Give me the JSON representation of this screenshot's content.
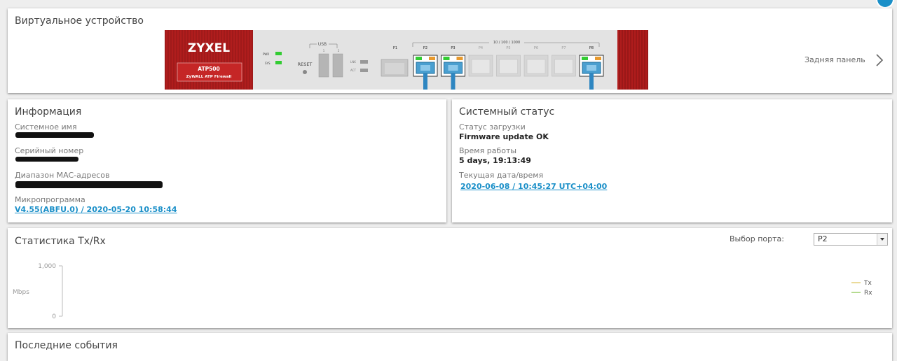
{
  "virtual_device": {
    "title": "Виртуальное устройство",
    "back_panel_label": "Задняя панель",
    "device": {
      "brand": "ZYXEL",
      "model": "ATP500",
      "subtitle": "ZyWALL ATP Firewall",
      "led_pwr": "PWR",
      "led_sys": "SYS",
      "usb_label": "USB",
      "usb_1": "1",
      "usb_2": "2",
      "reset_label": "RESET",
      "lnk_label": "LNK",
      "act_label": "ACT",
      "speed_label": "10 / 100 / 1000",
      "ports": [
        {
          "name": "P1",
          "type": "sfp"
        },
        {
          "name": "P2",
          "connected": true
        },
        {
          "name": "P3",
          "connected": true
        },
        {
          "name": "P4",
          "connected": false
        },
        {
          "name": "P5",
          "connected": false
        },
        {
          "name": "P6",
          "connected": false
        },
        {
          "name": "P7",
          "connected": false
        },
        {
          "name": "P8",
          "connected": true
        }
      ]
    }
  },
  "information": {
    "title": "Информация",
    "system_name_label": "Системное имя",
    "serial_label": "Серийный номер",
    "mac_range_label": "Диапазон MAC-адресов",
    "firmware_label": "Микропрограмма",
    "firmware_value": "V4.55(ABFU.0) / 2020-05-20 10:58:44"
  },
  "system_status": {
    "title": "Системный статус",
    "boot_status_label": "Статус загрузки",
    "boot_status_value": "Firmware update OK",
    "uptime_label": "Время работы",
    "uptime_value": "5 days, 19:13:49",
    "datetime_label": "Текущая дата/время",
    "datetime_value": "2020-06-08 / 10:45:27 UTC+04:00"
  },
  "txrx": {
    "title": "Статистика Tx/Rx",
    "port_select_label": "Выбор порта:",
    "port_selected": "P2",
    "y_axis_label": "Mbps",
    "y_ticks": [
      "1,000",
      "0"
    ],
    "legend": [
      {
        "name": "Tx",
        "color": "#e4cf78"
      },
      {
        "name": "Rx",
        "color": "#9ccf6a"
      }
    ],
    "chart_data": {
      "type": "line",
      "ylabel": "Mbps",
      "ylim": [
        0,
        1000
      ],
      "series": [
        {
          "name": "Tx",
          "values": []
        },
        {
          "name": "Rx",
          "values": []
        }
      ]
    }
  },
  "recent_events": {
    "title": "Последние события"
  },
  "colors": {
    "accent": "#1a8fc8",
    "device_red": "#b01c1c"
  }
}
